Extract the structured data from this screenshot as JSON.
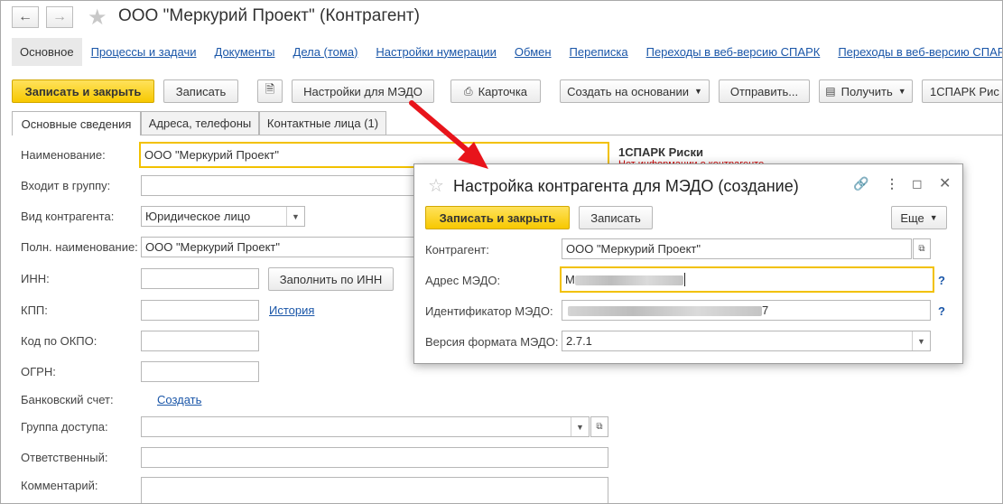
{
  "window": {
    "title": "ООО \"Меркурий Проект\" (Контрагент)",
    "back_icon": "arrow-left-icon",
    "forward_icon": "arrow-right-icon",
    "favorite_icon": "star-icon"
  },
  "nav": {
    "items": [
      "Основное",
      "Процессы и задачи",
      "Документы",
      "Дела (тома)",
      "Настройки нумерации",
      "Обмен",
      "Переписка",
      "Переходы в веб-версию СПАРК",
      "Переходы в веб-версию СПАРК"
    ]
  },
  "toolbar": {
    "save_close": "Записать и закрыть",
    "save": "Записать",
    "medo_settings": "Настройки для МЭДО",
    "card": "Карточка",
    "create_based": "Создать на основании",
    "send": "Отправить...",
    "receive": "Получить",
    "spark": "1СПАРК Рис"
  },
  "tabs": [
    "Основные сведения",
    "Адреса, телефоны",
    "Контактные лица (1)"
  ],
  "form": {
    "name_label": "Наименование:",
    "name_value": "ООО \"Меркурий Проект\"",
    "group_label": "Входит в группу:",
    "group_value": "",
    "kind_label": "Вид контрагента:",
    "kind_value": "Юридическое лицо",
    "fullname_label": "Полн. наименование:",
    "fullname_value": "ООО \"Меркурий Проект\"",
    "inn_label": "ИНН:",
    "fill_inn": "Заполнить по ИНН",
    "kpp_label": "КПП:",
    "history_link": "История",
    "okpo_label": "Код по ОКПО:",
    "ogrn_label": "ОГРН:",
    "bank_label": "Банковский счет:",
    "create_link": "Создать",
    "access_label": "Группа доступа:",
    "responsible_label": "Ответственный:",
    "comment_label": "Комментарий:"
  },
  "spark": {
    "title": "1СПАРК Риски",
    "subtitle": "Нет информации о контрагенте"
  },
  "dialog": {
    "title": "Настройка контрагента для МЭДО (создание)",
    "save_close": "Записать и закрыть",
    "save": "Записать",
    "more": "Еще",
    "counterparty_label": "Контрагент:",
    "counterparty_value": "ООО \"Меркурий Проект\"",
    "address_label": "Адрес МЭДО:",
    "address_value_start": "M",
    "id_label": "Идентификатор МЭДО:",
    "id_value_end": "7",
    "version_label": "Версия формата МЭДО:",
    "version_value": "2.7.1",
    "help": "?"
  },
  "colors": {
    "accent_yellow": "#f7c800",
    "link_blue": "#1a56a8",
    "arrow_red": "#e8141b"
  }
}
